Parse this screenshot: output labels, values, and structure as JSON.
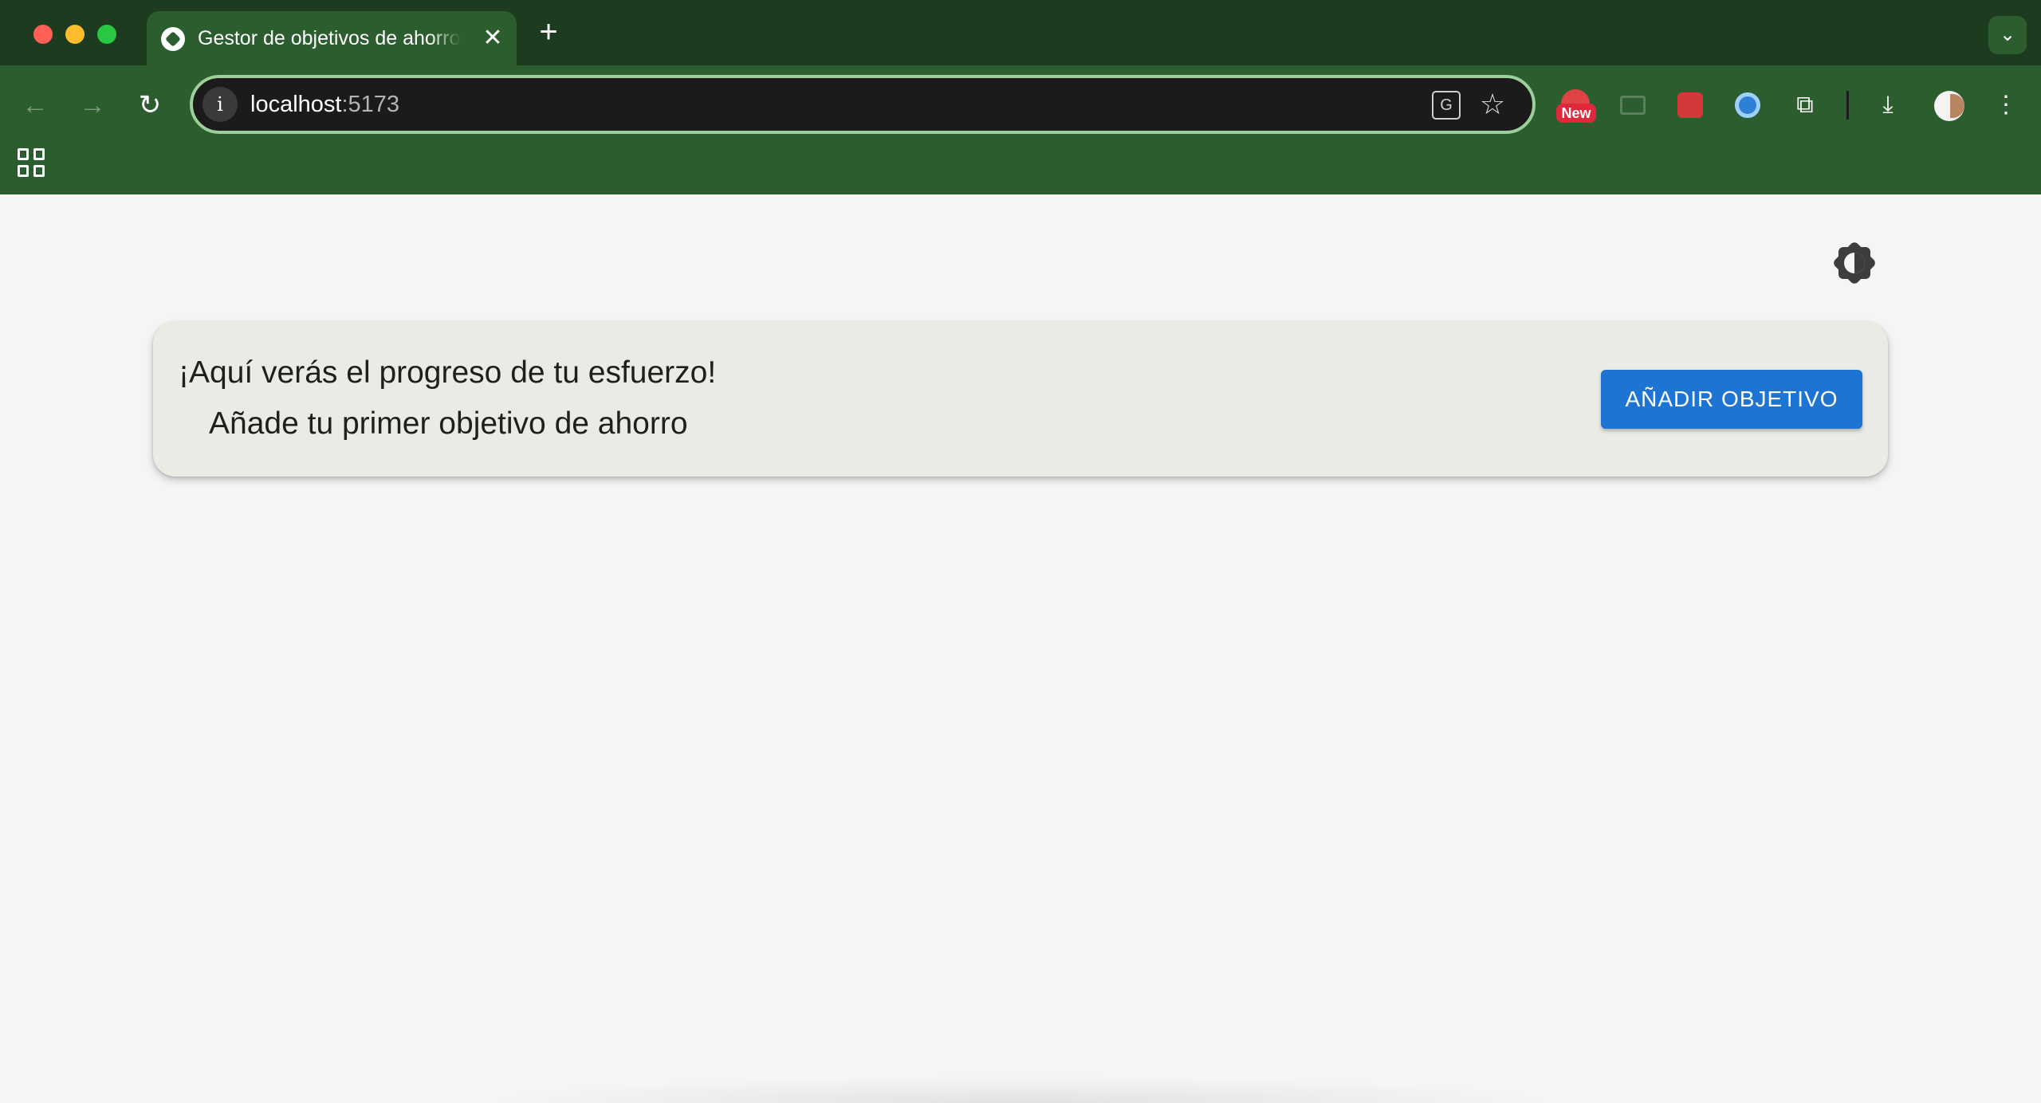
{
  "window": {
    "tab_title": "Gestor de objetivos de ahorro",
    "tab_close": "✕",
    "new_tab": "+",
    "tab_search": "⌄"
  },
  "toolbar": {
    "back": "←",
    "forward": "→",
    "reload": "↻",
    "address_host": "localhost",
    "address_port": ":5173",
    "info_icon": "i",
    "translate_icon": "G",
    "bookmark_icon": "☆",
    "extension_badge": "New",
    "puzzle_icon": "⧉",
    "download_icon": "⤓",
    "menu_icon": "⋮"
  },
  "main": {
    "empty_state_title": "¡Aquí verás el progreso de tu esfuerzo!",
    "empty_state_subtitle": "Añade tu primer objetivo de ahorro",
    "add_goal_label": "AÑADIR OBJETIVO"
  },
  "colors": {
    "browser_frame": "#1d3b1e",
    "toolbar": "#2b5d2e",
    "page_background": "#f5f5f5",
    "card_background": "#ebebe6",
    "primary_button": "#1d74d3"
  }
}
